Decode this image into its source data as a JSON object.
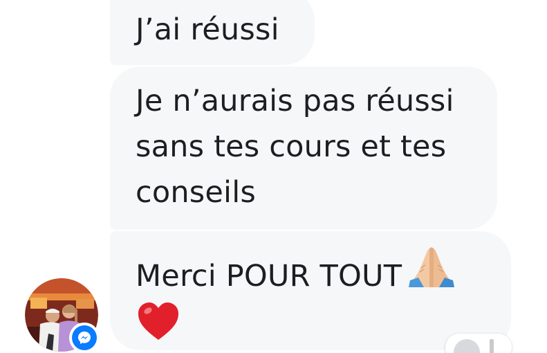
{
  "messages": [
    {
      "lines": [
        "J’ai réussi"
      ]
    },
    {
      "lines": [
        "Je n’aurais pas réussi",
        "sans tes cours et tes",
        "conseils"
      ]
    },
    {
      "lines": [
        "Merci POUR TOUT"
      ],
      "emojis": [
        "folded-hands-icon",
        "red-heart-icon"
      ]
    }
  ],
  "colors": {
    "bubble_bg": "#f6f7f9",
    "text": "#1c1e21",
    "messenger_blue": "#0a7cff"
  }
}
